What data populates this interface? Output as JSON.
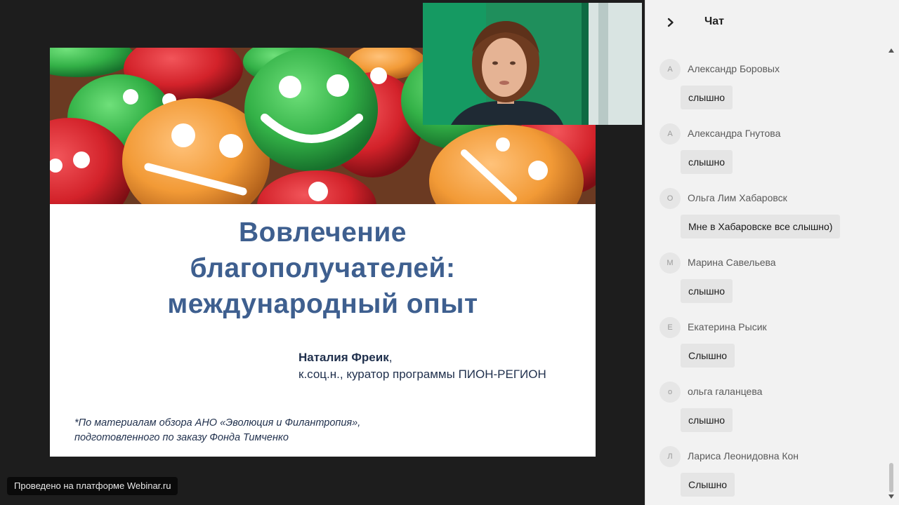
{
  "watermark": "Проведено на платформе Webinar.ru",
  "slide": {
    "title_lines": [
      "Вовлечение",
      "благополучателей:",
      "международный опыт"
    ],
    "author_name": "Наталия Фреик",
    "author_comma": ",",
    "author_affiliation": "к.соц.н., куратор программы ПИОН-РЕГИОН",
    "note_lines": [
      "*По материалам обзора АНО «Эволюция и Филантропия»,",
      "подготовленного по заказу Фонда Тимченко"
    ],
    "title_color": "#3e5f8f"
  },
  "chat": {
    "title": "Чат",
    "collapse_icon": "chevron-right-icon",
    "messages": [
      {
        "initial": "А",
        "sender": "Александр Боровых",
        "text": "слышно"
      },
      {
        "initial": "А",
        "sender": "Александра Гнутова",
        "text": "слышно"
      },
      {
        "initial": "О",
        "sender": "Ольга Лим Хабаровск",
        "text": "Мне в Хабаровске все слышно)"
      },
      {
        "initial": "М",
        "sender": "Марина Савельева",
        "text": "слышно"
      },
      {
        "initial": "Е",
        "sender": "Екатерина Рысик",
        "text": "Слышно"
      },
      {
        "initial": "о",
        "sender": "ольга галанцева",
        "text": "слышно"
      },
      {
        "initial": "Л",
        "sender": "Лариса Леонидовна Кон",
        "text": "Слышно"
      }
    ]
  },
  "colors": {
    "chat_bg": "#f2f2f2",
    "bubble_bg": "#e5e5e5",
    "stage_bg": "#1d1d1d",
    "smiley_green": "#37b64a",
    "smiley_red": "#d5222a",
    "smiley_orange": "#f39a36"
  }
}
